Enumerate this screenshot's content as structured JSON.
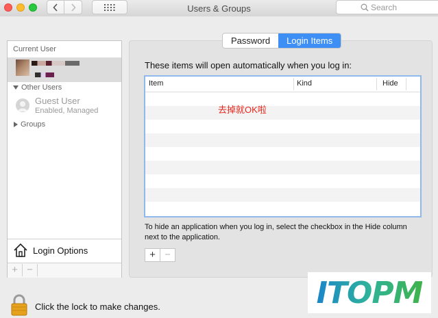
{
  "window": {
    "title": "Users & Groups"
  },
  "search": {
    "placeholder": "Search"
  },
  "sidebar": {
    "current_user_header": "Current User",
    "other_users_header": "Other Users",
    "guest": {
      "name": "Guest User",
      "status": "Enabled, Managed"
    },
    "groups_label": "Groups",
    "login_options_label": "Login Options",
    "add_symbol": "+",
    "remove_symbol": "−"
  },
  "tabs": [
    {
      "label": "Password",
      "active": false
    },
    {
      "label": "Login Items",
      "active": true
    }
  ],
  "login_items": {
    "description": "These items will open automatically when you log in:",
    "columns": [
      "Item",
      "Kind",
      "Hide"
    ],
    "annotation": "去掉就OK啦",
    "hint": "To hide an application when you log in, select the checkbox in the Hide column next to the application.",
    "add_symbol": "+",
    "remove_symbol": "−"
  },
  "lock": {
    "text": "Click the lock to make changes."
  },
  "watermark": {
    "text": "ITOPM"
  },
  "colors": {
    "accent": "#3d8ff6",
    "annotation": "#e5261c",
    "focus_border": "#8fb9ec"
  }
}
